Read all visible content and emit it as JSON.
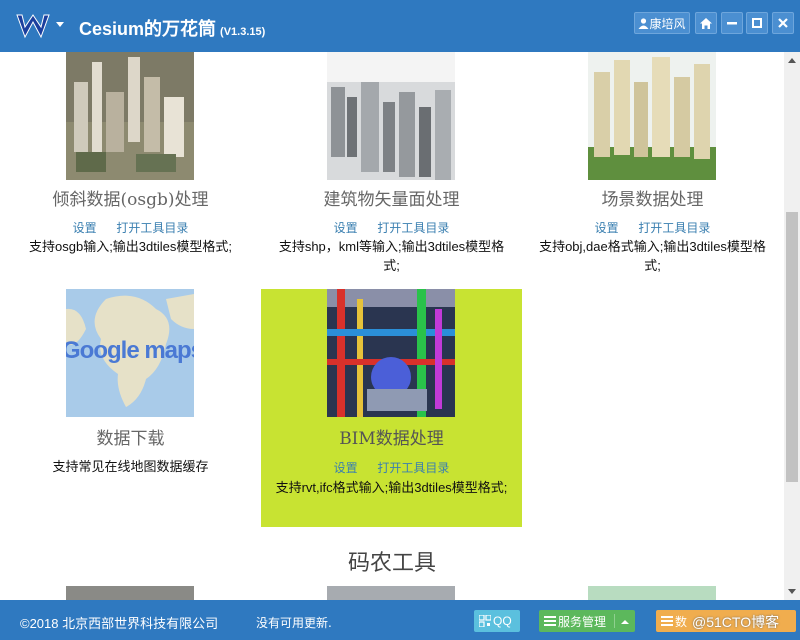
{
  "header": {
    "title": "Cesium的万花筒",
    "version": "(V1.3.15)",
    "user": "康培风",
    "colors": {
      "bar": "#2f79c0",
      "highlight": "#c8e332",
      "link": "#3a7fb0"
    }
  },
  "cards": [
    {
      "title": "倾斜数据(osgb)处理",
      "link1": "设置",
      "link2": "打开工具目录",
      "desc": "支持osgb输入;输出3dtiles模型格式;"
    },
    {
      "title": "建筑物矢量面处理",
      "link1": "设置",
      "link2": "打开工具目录",
      "desc": "支持shp，kml等输入;输出3dtiles模型格式;"
    },
    {
      "title": "场景数据处理",
      "link1": "设置",
      "link2": "打开工具目录",
      "desc": "支持obj,dae格式输入;输出3dtiles模型格式;"
    },
    {
      "title": "数据下载",
      "desc": "支持常见在线地图数据缓存",
      "thumb_text": "Google maps"
    },
    {
      "title": "BIM数据处理",
      "link1": "设置",
      "link2": "打开工具目录",
      "desc": "支持rvt,ifc格式输入;输出3dtiles模型格式;"
    }
  ],
  "section": {
    "title": "码农工具"
  },
  "footer": {
    "copyright": "©2018 北京西部世界科技有限公司",
    "update": "没有可用更新.",
    "qq": "QQ",
    "service": "服务管理",
    "data": "数",
    "watermark": "@51CTO博客"
  }
}
